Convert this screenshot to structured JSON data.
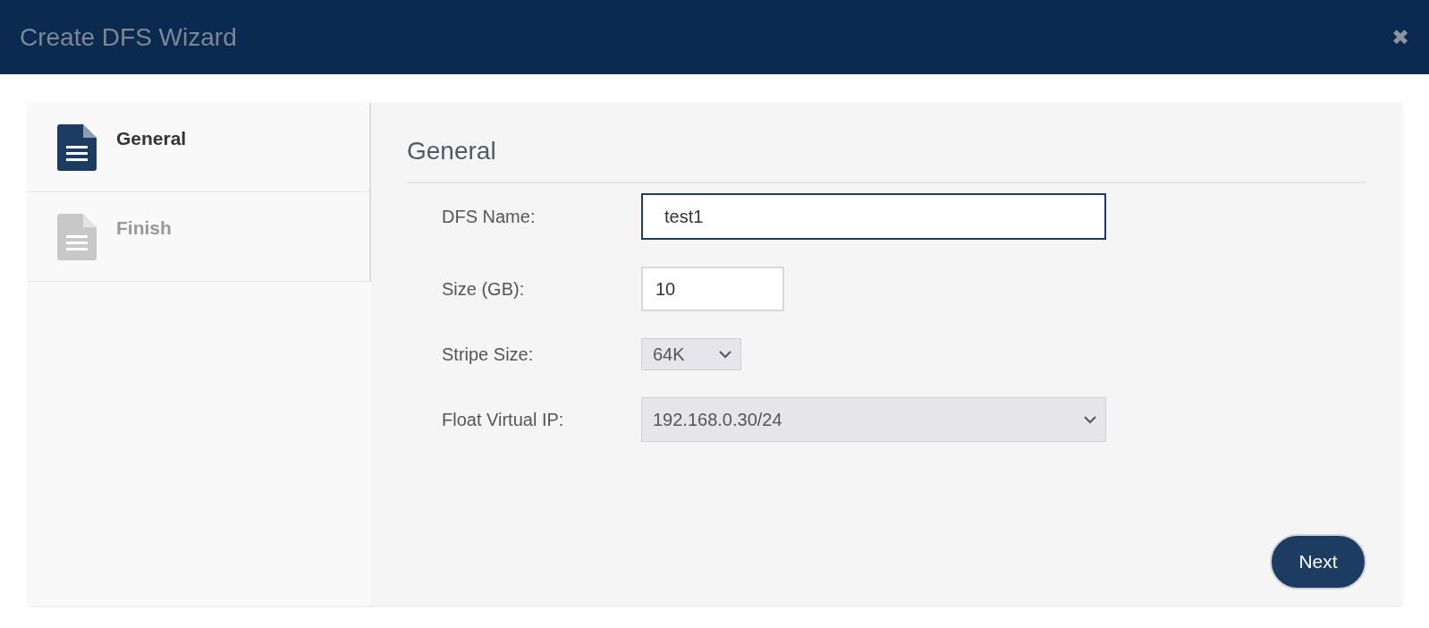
{
  "window": {
    "title": "Create DFS Wizard",
    "close": "✖"
  },
  "steps": [
    {
      "label": "General",
      "selected": true
    },
    {
      "label": "Finish",
      "selected": false
    }
  ],
  "panel": {
    "heading": "General",
    "fields": [
      {
        "kind": "text",
        "label": "DFS Name:",
        "value": "test1",
        "focused": true
      },
      {
        "kind": "text",
        "label": "Size (GB):",
        "value": "10",
        "focused": false
      },
      {
        "kind": "select",
        "label": "Stripe Size:",
        "value": "64K"
      },
      {
        "kind": "select",
        "label": "Float Virtual IP:",
        "value": "192.168.0.30/24"
      }
    ],
    "next_button": "Next"
  }
}
